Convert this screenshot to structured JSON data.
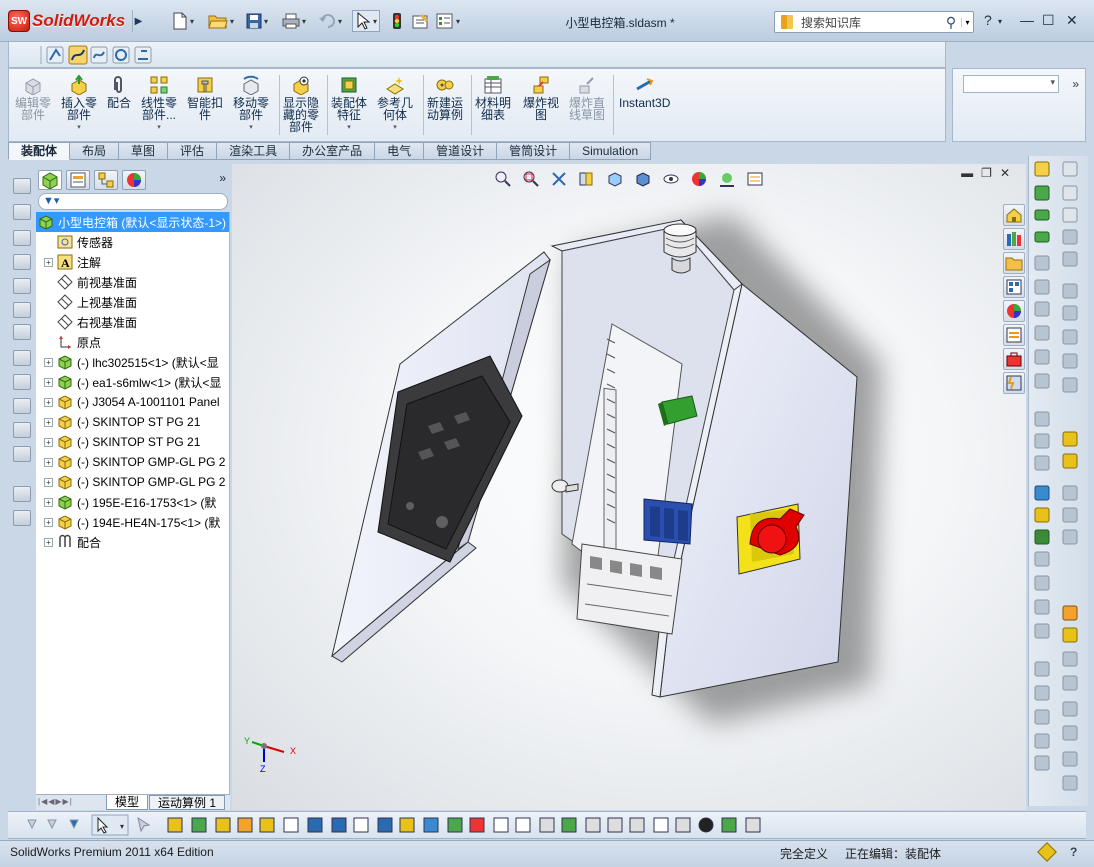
{
  "app": {
    "brand": "SolidWorks",
    "brand_badge": "SW",
    "document_title": "小型电控箱.sldasm *",
    "search_placeholder": "搜索知识库"
  },
  "ribbon": {
    "commands": [
      {
        "label": "编辑零\n部件",
        "enabled": false
      },
      {
        "label": "插入零\n部件",
        "enabled": true
      },
      {
        "label": "配合",
        "enabled": true
      },
      {
        "label": "线性零\n部件...",
        "enabled": true
      },
      {
        "label": "智能扣\n件",
        "enabled": true
      },
      {
        "label": "移动零\n部件",
        "enabled": true
      },
      {
        "label": "显示隐\n藏的零\n部件",
        "enabled": true
      },
      {
        "label": "装配体\n特征",
        "enabled": true
      },
      {
        "label": "参考几\n何体",
        "enabled": true
      },
      {
        "label": "新建运\n动算例",
        "enabled": true
      },
      {
        "label": "材料明\n细表",
        "enabled": true
      },
      {
        "label": "爆炸视\n图",
        "enabled": true
      },
      {
        "label": "爆炸直\n线草图",
        "enabled": false
      },
      {
        "label": "Instant3D",
        "enabled": true
      }
    ]
  },
  "tabs": [
    "装配体",
    "布局",
    "草图",
    "评估",
    "渲染工具",
    "办公室产品",
    "电气",
    "管道设计",
    "管筒设计",
    "Simulation"
  ],
  "active_tab": "装配体",
  "tree": {
    "root": "小型电控箱 (默认<显示状态-1>)",
    "items": [
      {
        "label": "传感器",
        "icon": "sensor-icon",
        "expandable": false
      },
      {
        "label": "注解",
        "icon": "annotation-icon",
        "expandable": true
      },
      {
        "label": "前视基准面",
        "icon": "plane-icon",
        "expandable": false
      },
      {
        "label": "上视基准面",
        "icon": "plane-icon",
        "expandable": false
      },
      {
        "label": "右视基准面",
        "icon": "plane-icon",
        "expandable": false
      },
      {
        "label": "原点",
        "icon": "origin-icon",
        "expandable": false
      },
      {
        "label": "(-) lhc302515<1> (默认<显",
        "icon": "subassembly-icon",
        "expandable": true
      },
      {
        "label": "(-) ea1-s6mlw<1> (默认<显",
        "icon": "subassembly-icon",
        "expandable": true
      },
      {
        "label": "(-) J3054 A-1001101 Panel",
        "icon": "part-icon",
        "expandable": true
      },
      {
        "label": "(-) SKINTOP ST PG 21",
        "icon": "part-icon",
        "expandable": true
      },
      {
        "label": "(-) SKINTOP ST PG 21",
        "icon": "part-icon",
        "expandable": true
      },
      {
        "label": "(-) SKINTOP GMP-GL PG 2",
        "icon": "part-icon",
        "expandable": true
      },
      {
        "label": "(-) SKINTOP GMP-GL PG 2",
        "icon": "part-icon",
        "expandable": true
      },
      {
        "label": "(-) 195E-E16-1753<1> (默",
        "icon": "subassembly-icon",
        "expandable": true
      },
      {
        "label": "(-) 194E-HE4N-175<1> (默",
        "icon": "part-icon",
        "expandable": true
      },
      {
        "label": "配合",
        "icon": "mates-icon",
        "expandable": true
      }
    ]
  },
  "bottom_tabs": [
    "模型",
    "运动算例 1"
  ],
  "triad": {
    "x": "X",
    "y": "Y",
    "z": "Z"
  },
  "status": {
    "edition": "SolidWorks Premium 2011 x64 Edition",
    "definition": "完全定义",
    "editing": "正在编辑：装配体",
    "help": "?"
  },
  "colors": {
    "brand_red": "#d01c0e",
    "tree_selection": "#3399ff",
    "enclosure": "#e9ecf6",
    "switch_red": "#e00000",
    "switch_yellow": "#f3e11a",
    "panel_dark": "#2a2a2a"
  }
}
